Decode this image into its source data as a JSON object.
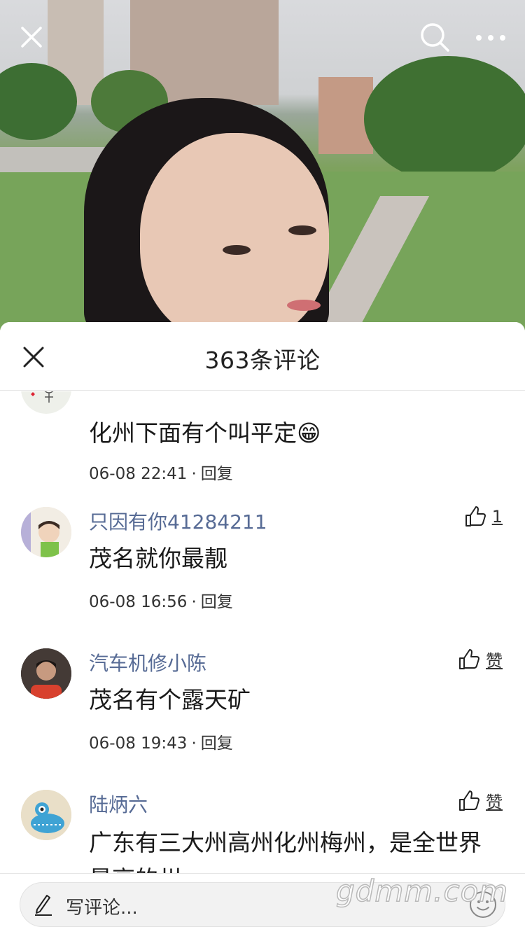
{
  "topbar": {
    "close_icon": "close-icon",
    "search_icon": "search-icon",
    "more_icon": "more-icon"
  },
  "sheet": {
    "title": "363条评论",
    "close_icon": "close-icon"
  },
  "comments": [
    {
      "username": "",
      "text": "化州下面有个叫平定😁",
      "time": "06-08 22:41",
      "separator": "·",
      "reply_label": "回复",
      "like_label": ""
    },
    {
      "username": "只因有你41284211",
      "text": "茂名就你最靓",
      "time": "06-08 16:56",
      "separator": "·",
      "reply_label": "回复",
      "like_label": "1"
    },
    {
      "username": "汽车机修小陈",
      "text": "茂名有个露天矿",
      "time": "06-08 19:43",
      "separator": "·",
      "reply_label": "回复",
      "like_label": "赞"
    },
    {
      "username": "陆炳六",
      "text": "广东有三大州高州化州梅州，是全世界最高的州",
      "time": "",
      "separator": "",
      "reply_label": "",
      "like_label": "赞"
    }
  ],
  "input": {
    "placeholder": "写评论...",
    "pen_icon": "pen-icon",
    "emoji_icon": "emoji-icon"
  },
  "watermark": "gdmm.com"
}
